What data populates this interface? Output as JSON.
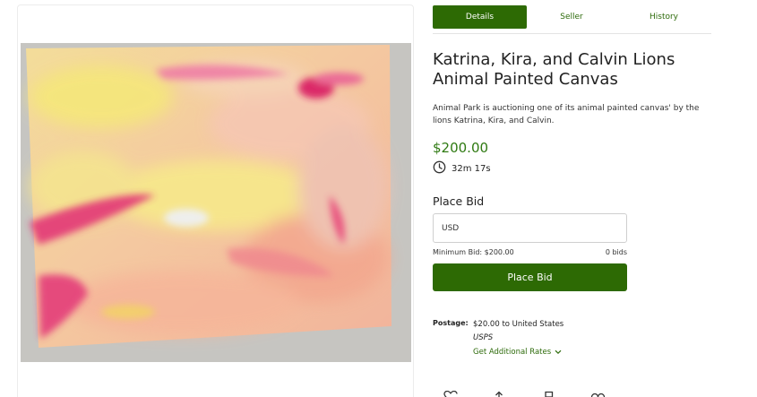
{
  "tabs": [
    {
      "label": "Details",
      "active": true
    },
    {
      "label": "Seller",
      "active": false
    },
    {
      "label": "History",
      "active": false
    }
  ],
  "listing": {
    "title": "Katrina, Kira, and Calvin Lions Animal Painted Canvas",
    "description": "Animal Park is auctioning one of its animal painted canvas' by the lions Katrina, Kira, and Calvin.",
    "price": "$200.00",
    "time_left": "32m 17s"
  },
  "bid": {
    "heading": "Place Bid",
    "input_placeholder": "USD",
    "minimum": "Minimum Bid: $200.00",
    "count": "0 bids",
    "button_label": "Place Bid"
  },
  "shipping": {
    "label": "Postage:",
    "value": "$20.00 to United States",
    "carrier": "USPS",
    "rates_link": "Get Additional Rates"
  },
  "icons": {
    "clock": "clock-icon",
    "heart": "heart-icon",
    "share": "share-icon",
    "flag": "flag-icon",
    "link": "link-icon"
  },
  "colors": {
    "accent": "#2d6a04",
    "price": "#2f7a12",
    "link": "#2e6b0b"
  }
}
